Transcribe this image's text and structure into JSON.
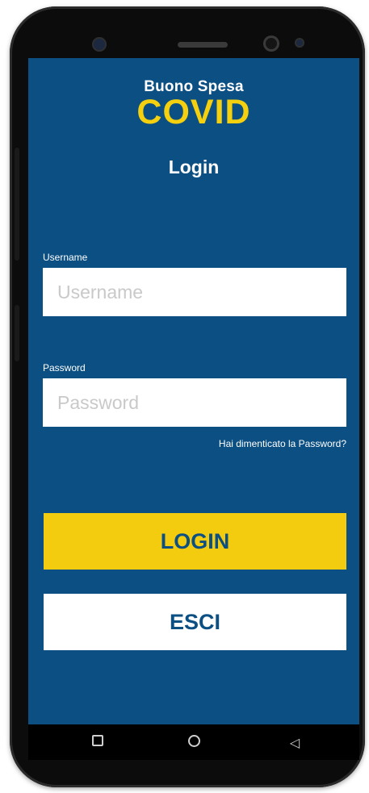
{
  "brand": {
    "top_line": "Buono Spesa",
    "main_line": "COVID",
    "colors": {
      "background": "#0b4f83",
      "accent": "#f4cc0f"
    }
  },
  "screen": {
    "title": "Login"
  },
  "username": {
    "label": "Username",
    "value": "",
    "placeholder": "Username"
  },
  "password": {
    "label": "Password",
    "value": "",
    "placeholder": "Password"
  },
  "forgot_password": "Hai dimenticato la Password?",
  "buttons": {
    "login": "LOGIN",
    "exit": "ESCI"
  },
  "navbar": {
    "icons": [
      "recent-apps-icon",
      "home-icon",
      "back-icon"
    ]
  }
}
